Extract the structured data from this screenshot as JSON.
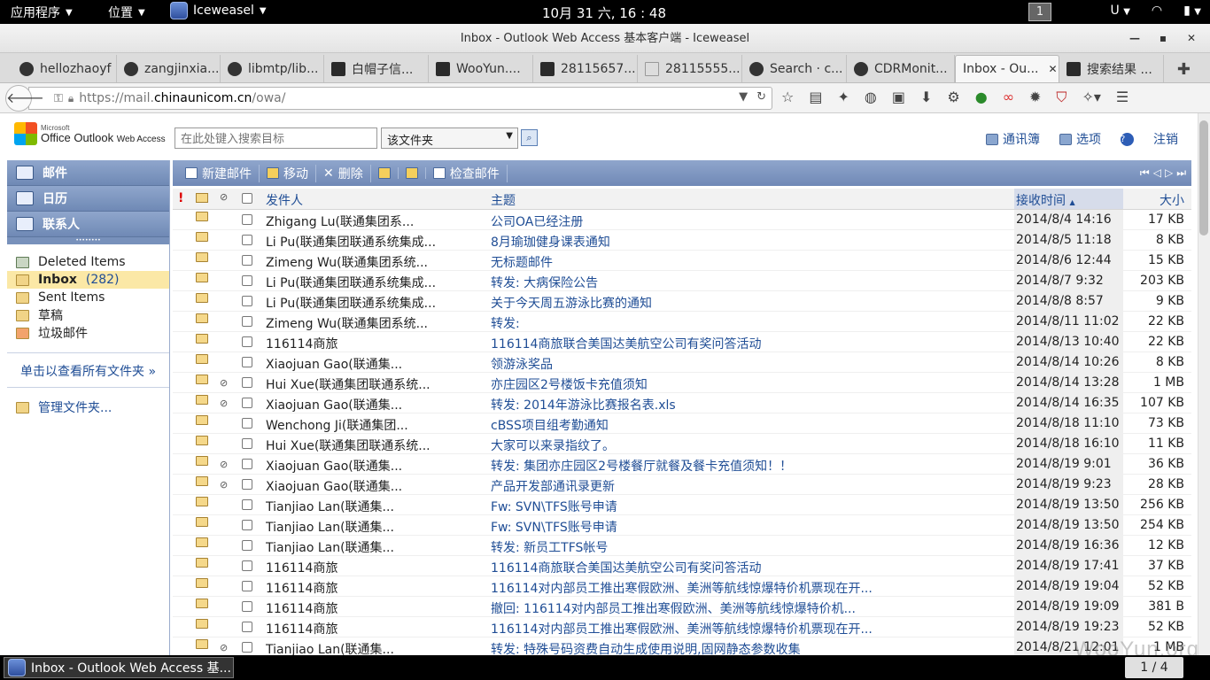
{
  "topbar": {
    "apps": "应用程序",
    "places": "位置",
    "browser": "Iceweasel",
    "clock": "10月 31 六, 16 : 48",
    "workspace": "1",
    "input_method": "U"
  },
  "window": {
    "title": "Inbox - Outlook Web Access 基本客户端 - Iceweasel"
  },
  "tabs": [
    {
      "label": "hellozhaoyf",
      "icon": "github-icon"
    },
    {
      "label": "zangjinxia...",
      "icon": "github-icon"
    },
    {
      "label": "libmtp/lib...",
      "icon": "github-icon"
    },
    {
      "label": "白帽子信...",
      "icon": "hat-icon"
    },
    {
      "label": "WooYun....",
      "icon": "wooyun-icon"
    },
    {
      "label": "28115657...",
      "icon": "hat-icon"
    },
    {
      "label": "28115555...",
      "icon": "page-icon"
    },
    {
      "label": "Search · c...",
      "icon": "github-icon"
    },
    {
      "label": "CDRMonit...",
      "icon": "github-icon"
    },
    {
      "label": "Inbox - Ou...",
      "icon": "",
      "active": true
    },
    {
      "label": "搜索结果 ...",
      "icon": "hat-icon"
    }
  ],
  "nav": {
    "url_prefix": "https://mail.",
    "url_host": "chinaunicom.cn",
    "url_path": "/owa/"
  },
  "owa": {
    "logo_ms": "Microsoft",
    "logo_main": "Office Outlook",
    "logo_sub": "Web Access",
    "search_placeholder": "在此处键入搜索目标",
    "scope": "该文件夹",
    "links": {
      "contacts": "通讯簿",
      "options": "选项",
      "logout": "注销"
    }
  },
  "modules": [
    "邮件",
    "日历",
    "联系人"
  ],
  "folders": [
    {
      "name": "Deleted Items",
      "count": ""
    },
    {
      "name": "Inbox",
      "count": "(282)",
      "selected": true
    },
    {
      "name": "Sent Items",
      "count": ""
    },
    {
      "name": "草稿",
      "count": ""
    },
    {
      "name": "垃圾邮件",
      "count": ""
    }
  ],
  "all_folders": "单击以查看所有文件夹 »",
  "manage_folders": "管理文件夹...",
  "toolbar": {
    "new_mail": "新建邮件",
    "move": "移动",
    "delete": "删除",
    "check_mail": "检查邮件"
  },
  "list_headers": {
    "sender": "发件人",
    "subject": "主题",
    "received": "接收时间",
    "size": "大小"
  },
  "emails": [
    {
      "sender": "Zhigang Lu(联通集团系...",
      "subject": "公司OA已经注册",
      "date": "2014/8/4 14:16",
      "size": "17 KB",
      "attach": false
    },
    {
      "sender": "Li Pu(联通集团联通系统集成...",
      "subject": "8月瑜珈健身课表通知",
      "date": "2014/8/5 11:18",
      "size": "8 KB",
      "attach": false
    },
    {
      "sender": "Zimeng Wu(联通集团系统...",
      "subject": "无标题邮件",
      "date": "2014/8/6 12:44",
      "size": "15 KB",
      "attach": false
    },
    {
      "sender": "Li Pu(联通集团联通系统集成...",
      "subject": "转发: 大病保险公告",
      "date": "2014/8/7 9:32",
      "size": "203 KB",
      "attach": false
    },
    {
      "sender": "Li Pu(联通集团联通系统集成...",
      "subject": "关于今天周五游泳比赛的通知",
      "date": "2014/8/8 8:57",
      "size": "9 KB",
      "attach": false
    },
    {
      "sender": "Zimeng Wu(联通集团系统...",
      "subject": "转发:",
      "date": "2014/8/11 11:02",
      "size": "22 KB",
      "attach": false
    },
    {
      "sender": "116114商旅",
      "subject": "116114商旅联合美国达美航空公司有奖问答活动",
      "date": "2014/8/13 10:40",
      "size": "22 KB",
      "attach": false
    },
    {
      "sender": "Xiaojuan Gao(联通集...",
      "subject": "领游泳奖品",
      "date": "2014/8/14 10:26",
      "size": "8 KB",
      "attach": false
    },
    {
      "sender": "Hui Xue(联通集团联通系统...",
      "subject": "亦庄园区2号楼饭卡充值须知",
      "date": "2014/8/14 13:28",
      "size": "1 MB",
      "attach": true
    },
    {
      "sender": "Xiaojuan Gao(联通集...",
      "subject": "转发: 2014年游泳比赛报名表.xls",
      "date": "2014/8/14 16:35",
      "size": "107 KB",
      "attach": true
    },
    {
      "sender": "Wenchong Ji(联通集团...",
      "subject": "cBSS项目组考勤通知",
      "date": "2014/8/18 11:10",
      "size": "73 KB",
      "attach": false
    },
    {
      "sender": "Hui Xue(联通集团联通系统...",
      "subject": "大家可以来录指纹了。",
      "date": "2014/8/18 16:10",
      "size": "11 KB",
      "attach": false
    },
    {
      "sender": "Xiaojuan Gao(联通集...",
      "subject": "转发: 集团亦庄园区2号楼餐厅就餐及餐卡充值须知！！",
      "date": "2014/8/19 9:01",
      "size": "36 KB",
      "attach": true
    },
    {
      "sender": "Xiaojuan Gao(联通集...",
      "subject": "产品开发部通讯录更新",
      "date": "2014/8/19 9:23",
      "size": "28 KB",
      "attach": true
    },
    {
      "sender": "Tianjiao Lan(联通集...",
      "subject": "Fw: SVN\\TFS账号申请",
      "date": "2014/8/19 13:50",
      "size": "256 KB",
      "attach": false
    },
    {
      "sender": "Tianjiao Lan(联通集...",
      "subject": "Fw: SVN\\TFS账号申请",
      "date": "2014/8/19 13:50",
      "size": "254 KB",
      "attach": false
    },
    {
      "sender": "Tianjiao Lan(联通集...",
      "subject": "转发: 新员工TFS帐号",
      "date": "2014/8/19 16:36",
      "size": "12 KB",
      "attach": false
    },
    {
      "sender": "116114商旅",
      "subject": "116114商旅联合美国达美航空公司有奖问答活动",
      "date": "2014/8/19 17:41",
      "size": "37 KB",
      "attach": false
    },
    {
      "sender": "116114商旅",
      "subject": "116114对内部员工推出寒假欧洲、美洲等航线惊爆特价机票现在开...",
      "date": "2014/8/19 19:04",
      "size": "52 KB",
      "attach": false
    },
    {
      "sender": "116114商旅",
      "subject": "撤回: 116114对内部员工推出寒假欧洲、美洲等航线惊爆特价机...",
      "date": "2014/8/19 19:09",
      "size": "381 B",
      "attach": false
    },
    {
      "sender": "116114商旅",
      "subject": "116114对内部员工推出寒假欧洲、美洲等航线惊爆特价机票现在开...",
      "date": "2014/8/19 19:23",
      "size": "52 KB",
      "attach": false
    },
    {
      "sender": "Tianjiao Lan(联通集...",
      "subject": "转发: 特殊号码资费自动生成使用说明,固网静态参数收集",
      "date": "2014/8/21 12:01",
      "size": "1 MB",
      "attach": true
    }
  ],
  "taskbar": {
    "task": "Inbox - Outlook Web Access 基...",
    "pages": "1 / 4"
  },
  "watermark": "WooYun.org"
}
